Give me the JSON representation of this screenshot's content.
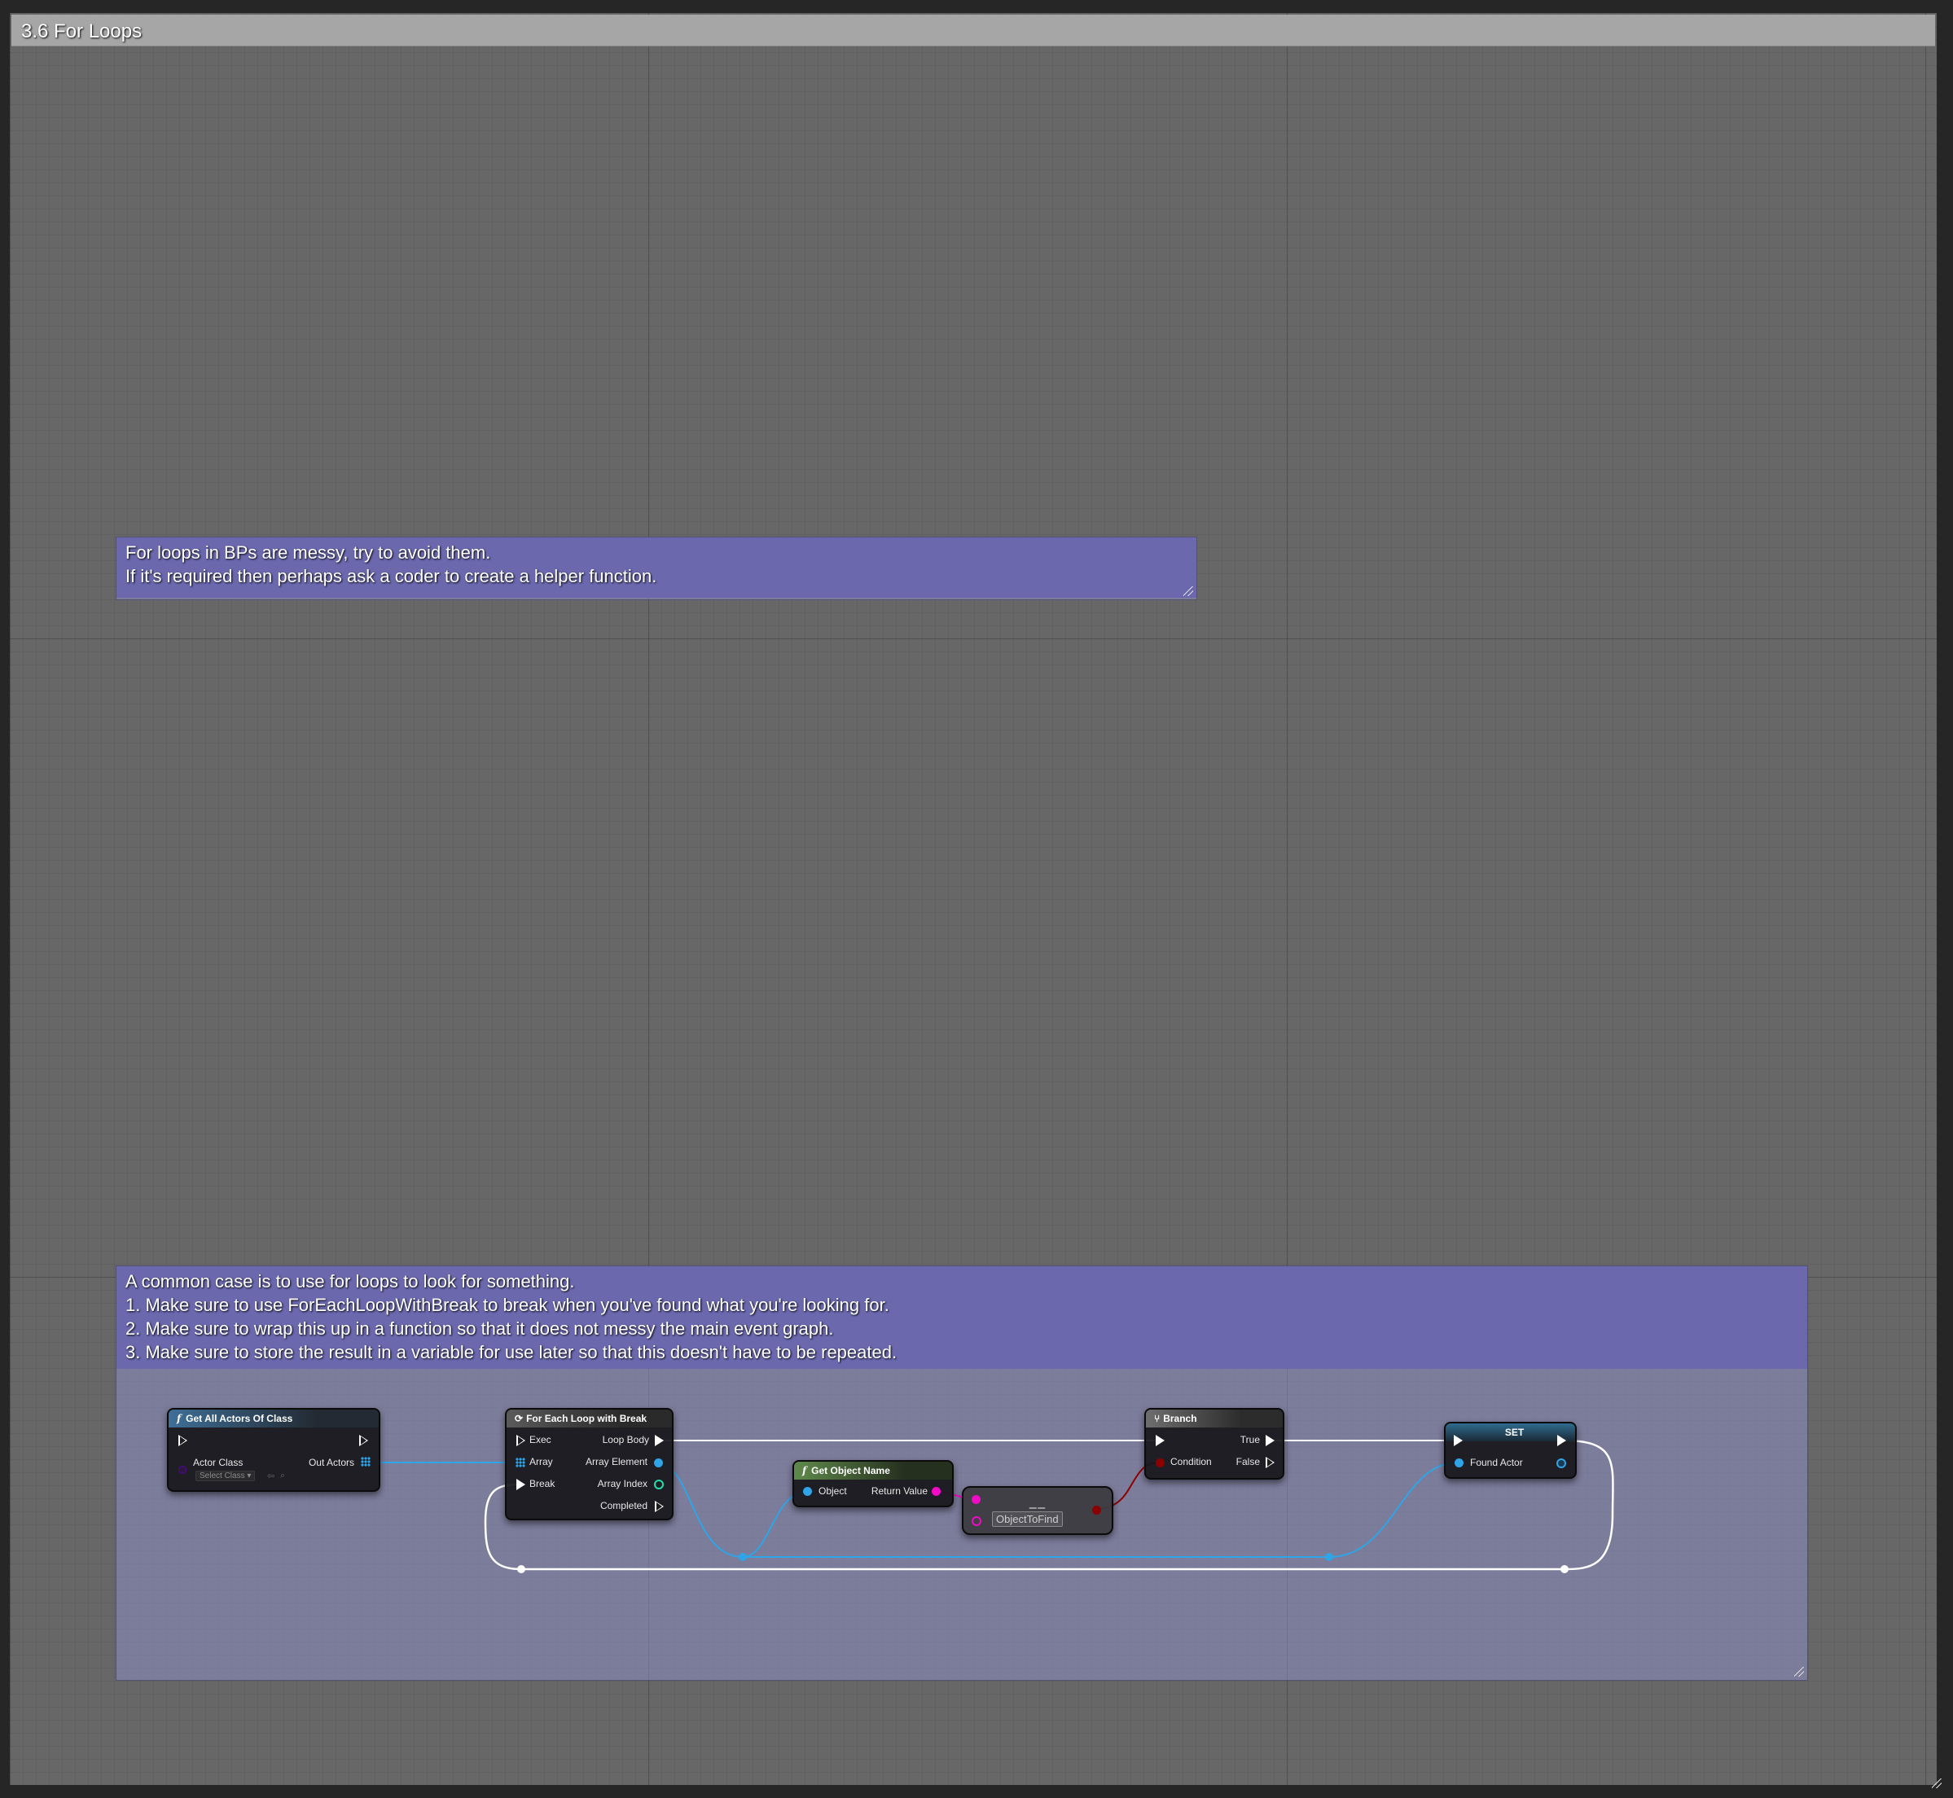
{
  "outer_comment": {
    "title": "3.6 For Loops"
  },
  "comments": [
    {
      "text": "For loops in BPs are messy, try to avoid them.\nIf it's required then perhaps ask a coder to create a helper function."
    },
    {
      "text": "A common case is to use for loops to look for something.\n1. Make sure to use ForEachLoopWithBreak to break when you've found what you're looking for.\n2. Make sure to wrap this up in a function so that it does not messy the main event graph.\n3. Make sure to store the result in a variable for use later so that this doesn't have to be repeated."
    }
  ],
  "nodes": {
    "get_all_actors": {
      "title": "Get All Actors Of Class",
      "actor_class": "Actor Class",
      "select_class": "Select Class",
      "out_actors": "Out Actors"
    },
    "for_each": {
      "title": "For Each Loop with Break",
      "exec": "Exec",
      "array": "Array",
      "break": "Break",
      "loop_body": "Loop Body",
      "array_element": "Array Element",
      "array_index": "Array Index",
      "completed": "Completed"
    },
    "get_object_name": {
      "title": "Get Object Name",
      "object": "Object",
      "return_value": "Return Value"
    },
    "equal": {
      "symbol": "==",
      "input_value": "ObjectToFind"
    },
    "branch": {
      "title": "Branch",
      "condition": "Condition",
      "true": "True",
      "false": "False"
    },
    "set": {
      "title": "SET",
      "found_actor": "Found Actor"
    }
  },
  "colors": {
    "object_pin": "#2fa4e6",
    "string_pin": "#f10bc6",
    "bool_pin": "#8d0000",
    "int_pin": "#1fe0a6",
    "class_pin": "#5a00a0",
    "exec_wire": "#ffffff",
    "comment_header": "#6b68ae"
  }
}
